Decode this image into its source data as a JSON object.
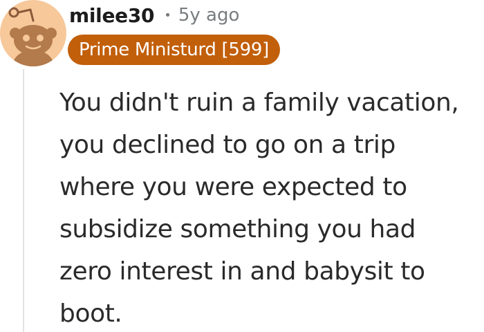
{
  "comment": {
    "avatar_icon": "snoo-avatar-icon",
    "username": "milee30",
    "separator": "•",
    "timestamp": "5y ago",
    "flair": "Prime Ministurd [599]",
    "body": "You didn't ruin a family vacation, you declined to go on a trip where you were expected to subsidize something you had zero interest in and babysit to boot."
  },
  "colors": {
    "avatar_bg": "#f6c89a",
    "flair_bg": "#c25f0a",
    "username": "#1c1c1c",
    "meta_gray": "#787c7e",
    "body_text": "#2a2a2a"
  }
}
